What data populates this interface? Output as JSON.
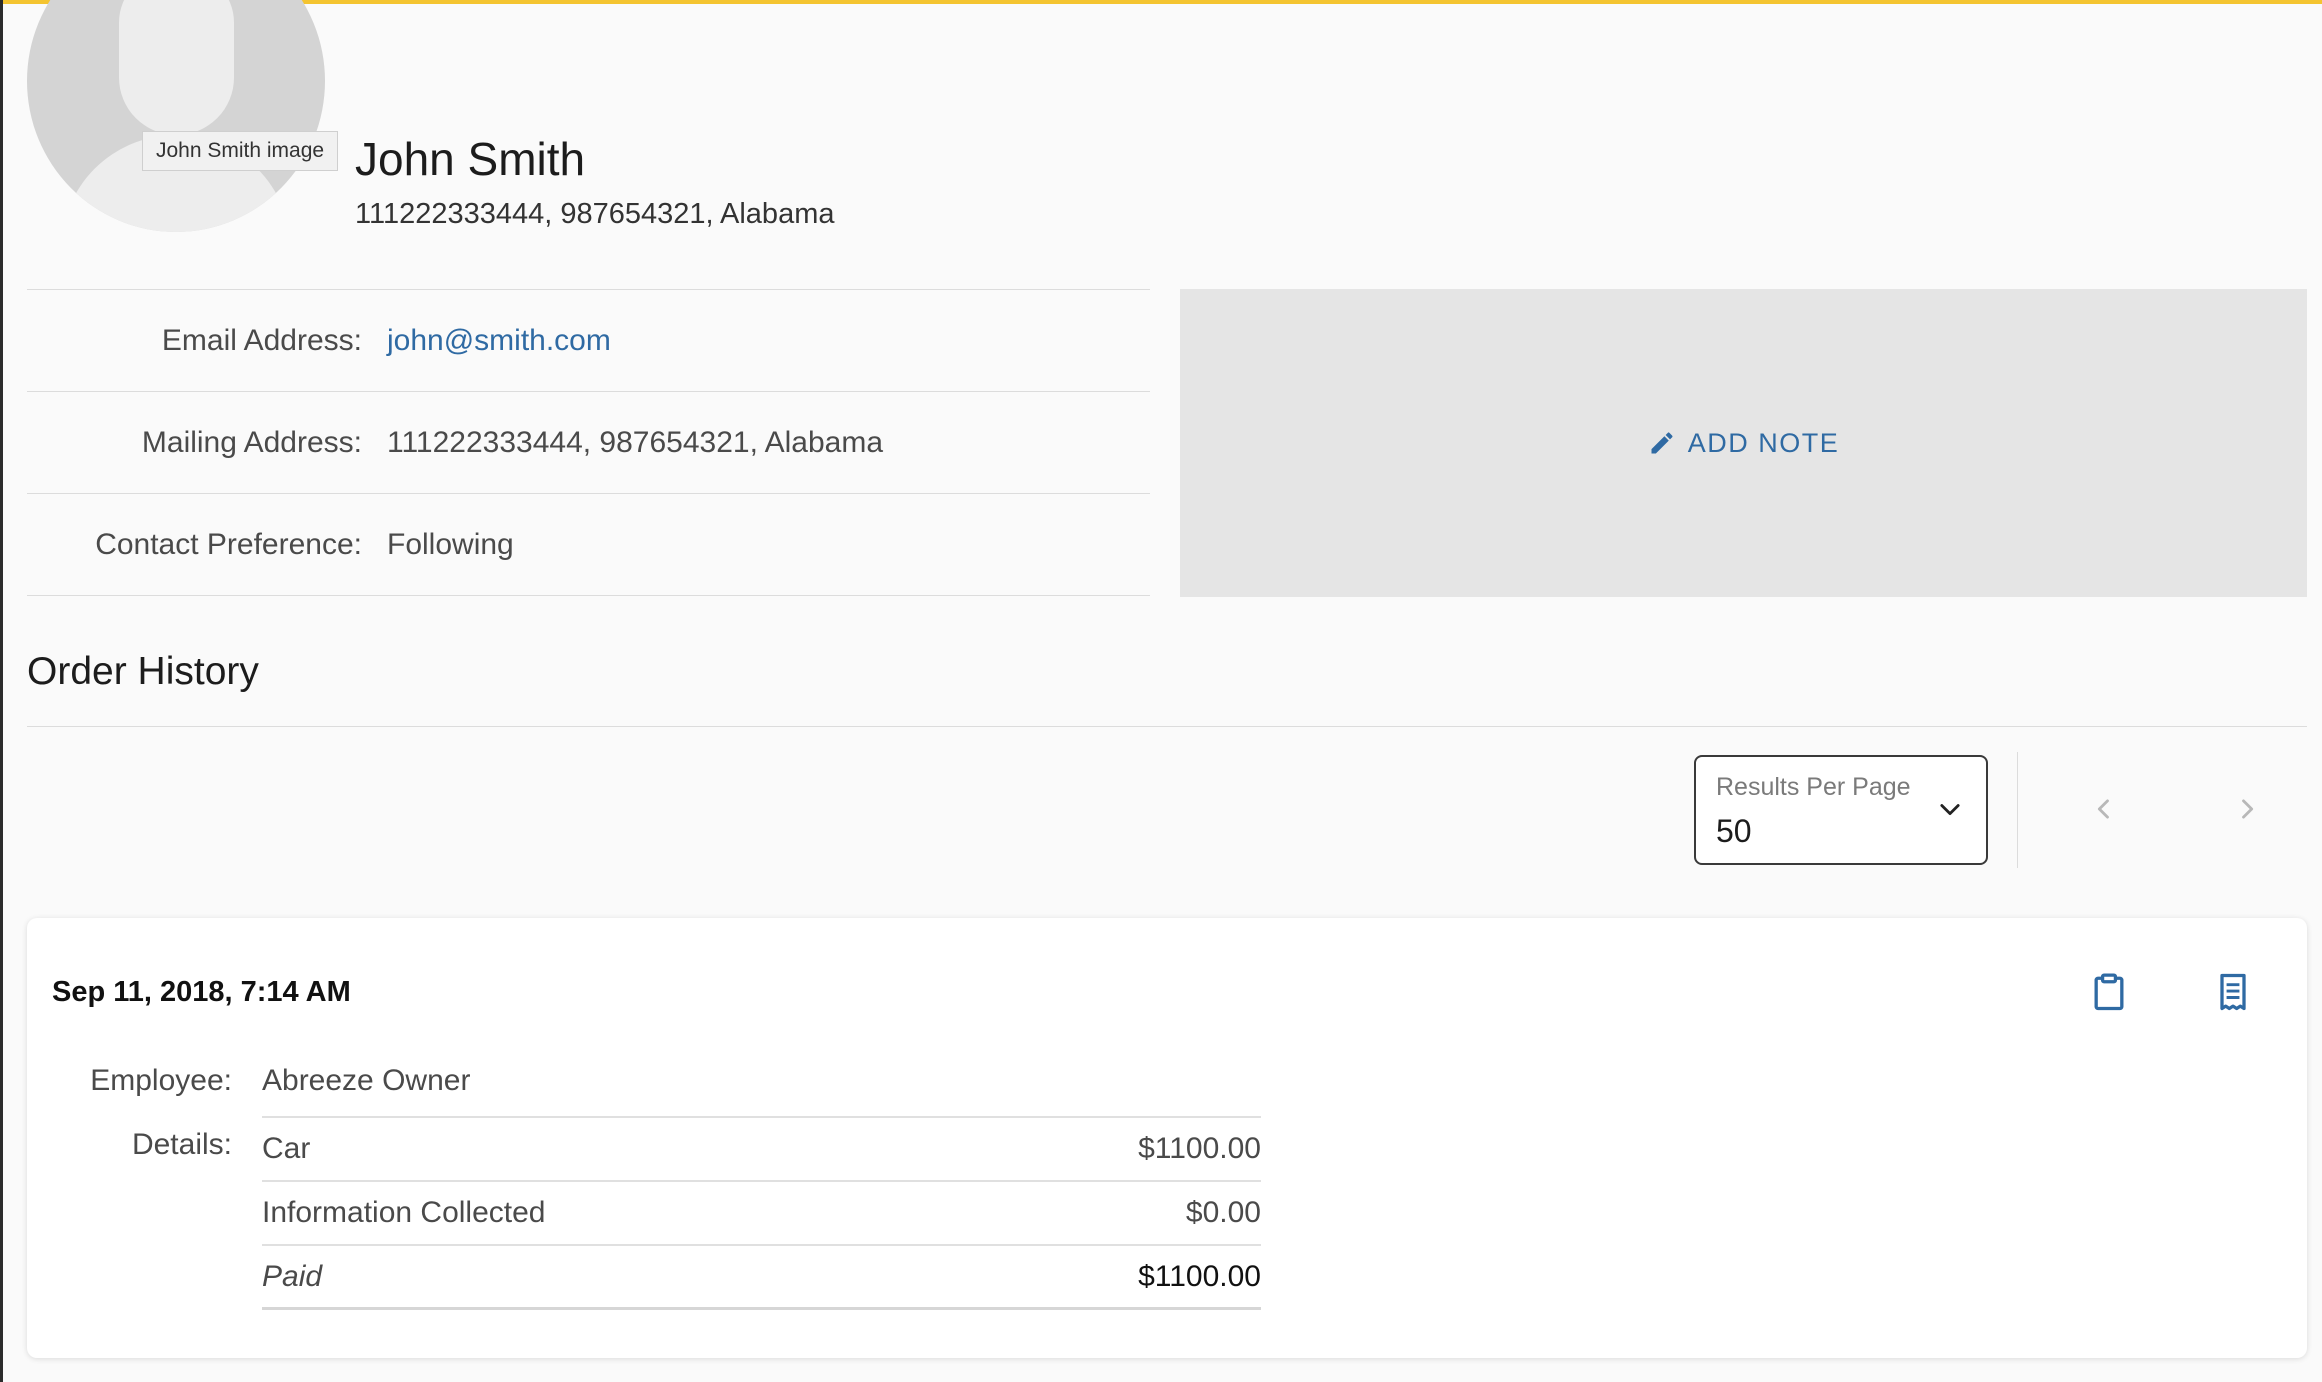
{
  "customer": {
    "name": "John Smith",
    "subtitle": "111222333444, 987654321, Alabama",
    "avatar_tooltip": "John Smith image"
  },
  "info_rows": [
    {
      "label": "Email Address:",
      "value": "john@smith.com"
    },
    {
      "label": "Mailing Address:",
      "value": "111222333444, 987654321, Alabama"
    },
    {
      "label": "Contact Preference:",
      "value": "Following"
    }
  ],
  "note": {
    "label": "ADD NOTE",
    "icon": "pencil-icon"
  },
  "order_history": {
    "title": "Order History",
    "results_per_page": {
      "label": "Results Per Page",
      "value": "50"
    },
    "orders": [
      {
        "date": "Sep 11, 2018, 7:14 AM",
        "employee_label": "Employee:",
        "employee": "Abreeze Owner",
        "details_label": "Details:",
        "details": [
          {
            "label": "Car",
            "amount": "$1100.00"
          },
          {
            "label": "Information Collected",
            "amount": "$0.00"
          },
          {
            "label": "Paid",
            "amount": "$1100.00"
          }
        ]
      }
    ]
  },
  "colors": {
    "accent": "#f4c430",
    "link": "#2f6aa3",
    "note_bg": "#e5e5e5"
  }
}
